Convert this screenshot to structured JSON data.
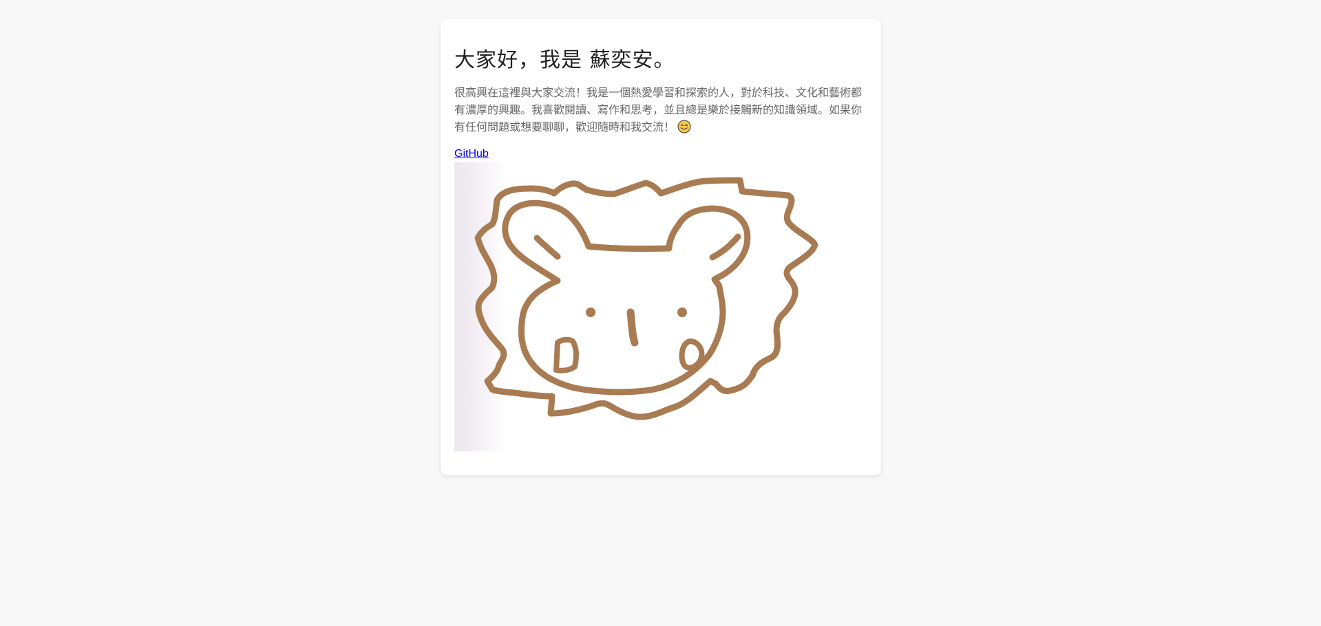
{
  "profile": {
    "heading": "大家好，我是 蘇奕安。",
    "intro": "很高興在這裡與大家交流！我是一個熱愛學習和探索的人，對於科技、文化和藝術都有濃厚的興趣。我喜歡閱讀、寫作和思考，並且總是樂於接觸新的知識領域。如果你有任何問題或想要聊聊，歡迎隨時和我交流！",
    "emoji_icon": "smiling-face-icon",
    "link_label": "GitHub",
    "drawing_icon": "bear-face-doodle-icon"
  },
  "colors": {
    "page_background": "#f8f8f8",
    "card_background": "#ffffff",
    "heading": "#222222",
    "body_text": "#666666",
    "link": "#0000ee",
    "doodle_stroke": "#a87b52"
  }
}
